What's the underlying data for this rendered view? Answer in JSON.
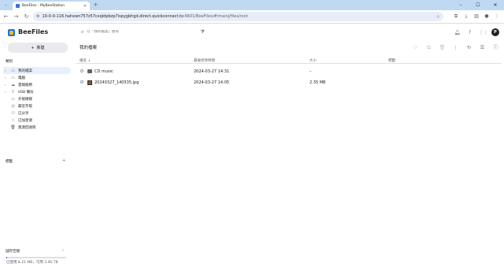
{
  "browser": {
    "tab_title": "BeeFiles - MyBeeStation",
    "new_tab": "+",
    "url_main": "10-0-0-116.hahxwn757z57cxqldpbzp7ispygbhgd.direct.quickconnect.to",
    "url_rest": ":6601/BeeFiles/#/mainj/files/root"
  },
  "app": {
    "brand": "BeeFiles",
    "search_placeholder": "在「我的檔案」搜尋",
    "avatar_letter": "P"
  },
  "sidebar": {
    "new_label": "新建",
    "section_browse": "類別",
    "items": [
      {
        "label": "我的檔案",
        "icon": "folder-icon",
        "active": true,
        "expandable": true
      },
      {
        "label": "電腦",
        "icon": "computer-icon",
        "active": false,
        "expandable": true
      },
      {
        "label": "雲端服務",
        "icon": "cloud-icon",
        "active": false,
        "expandable": true
      },
      {
        "label": "USB 備份",
        "icon": "usb-icon",
        "active": false,
        "expandable": true
      },
      {
        "label": "外接硬碟",
        "icon": "drive-icon",
        "active": false,
        "expandable": false
      },
      {
        "label": "最近存取",
        "icon": "clock-icon",
        "active": false,
        "expandable": false
      },
      {
        "label": "已分享",
        "icon": "share-icon",
        "active": false,
        "expandable": false
      },
      {
        "label": "已加星號",
        "icon": "star-icon",
        "active": false,
        "expandable": false
      },
      {
        "label": "資源回收筒",
        "icon": "trash-icon",
        "active": false,
        "expandable": false
      }
    ],
    "section_tags": "標籤",
    "section_storage": "儲存空間",
    "storage_text": "已使用 8.21 MB，可用 3.46 TB",
    "storage_used_fraction": 0.01
  },
  "main": {
    "title": "我的檔案",
    "columns": {
      "name": "檔名 ↓",
      "modified": "最後修改時間",
      "size": "大小",
      "tags": "標籤"
    },
    "rows": [
      {
        "name": "CD music",
        "type": "folder",
        "modified": "2024-03-27 14:31",
        "size": "–"
      },
      {
        "name": "20240327_140535.jpg",
        "type": "image",
        "modified": "2024-03-27 14:05",
        "size": "2.35 MB"
      }
    ]
  },
  "colors": {
    "accent": "#1a73e8",
    "active_bg": "#e8f0fe",
    "tabstrip": "#bfd9f2"
  }
}
